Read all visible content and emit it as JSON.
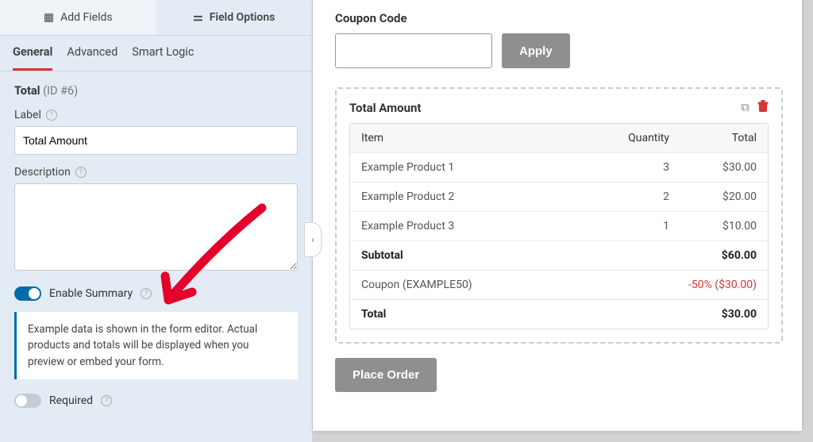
{
  "tabs_top": {
    "add_fields": "Add Fields",
    "field_options": "Field Options"
  },
  "tabs_sub": {
    "general": "General",
    "advanced": "Advanced",
    "smart_logic": "Smart Logic"
  },
  "field": {
    "name": "Total",
    "id": "(ID #6)"
  },
  "labels": {
    "label": "Label",
    "description": "Description",
    "enable_summary": "Enable Summary",
    "required": "Required"
  },
  "inputs": {
    "label_value": "Total Amount",
    "description_value": ""
  },
  "info_text": "Example data is shown in the form editor. Actual products and totals will be displayed when you preview or embed your form.",
  "coupon": {
    "label": "Coupon Code",
    "apply": "Apply"
  },
  "total_box": {
    "title": "Total Amount"
  },
  "table": {
    "headers": {
      "item": "Item",
      "quantity": "Quantity",
      "total": "Total"
    },
    "rows": [
      {
        "item": "Example Product 1",
        "qty": "3",
        "total": "$30.00"
      },
      {
        "item": "Example Product 2",
        "qty": "2",
        "total": "$20.00"
      },
      {
        "item": "Example Product 3",
        "qty": "1",
        "total": "$10.00"
      }
    ],
    "subtotal": {
      "label": "Subtotal",
      "value": "$60.00"
    },
    "coupon_row": {
      "label": "Coupon (EXAMPLE50)",
      "value": "-50% ($30.00)"
    },
    "total_row": {
      "label": "Total",
      "value": "$30.00"
    }
  },
  "place_order": "Place Order"
}
